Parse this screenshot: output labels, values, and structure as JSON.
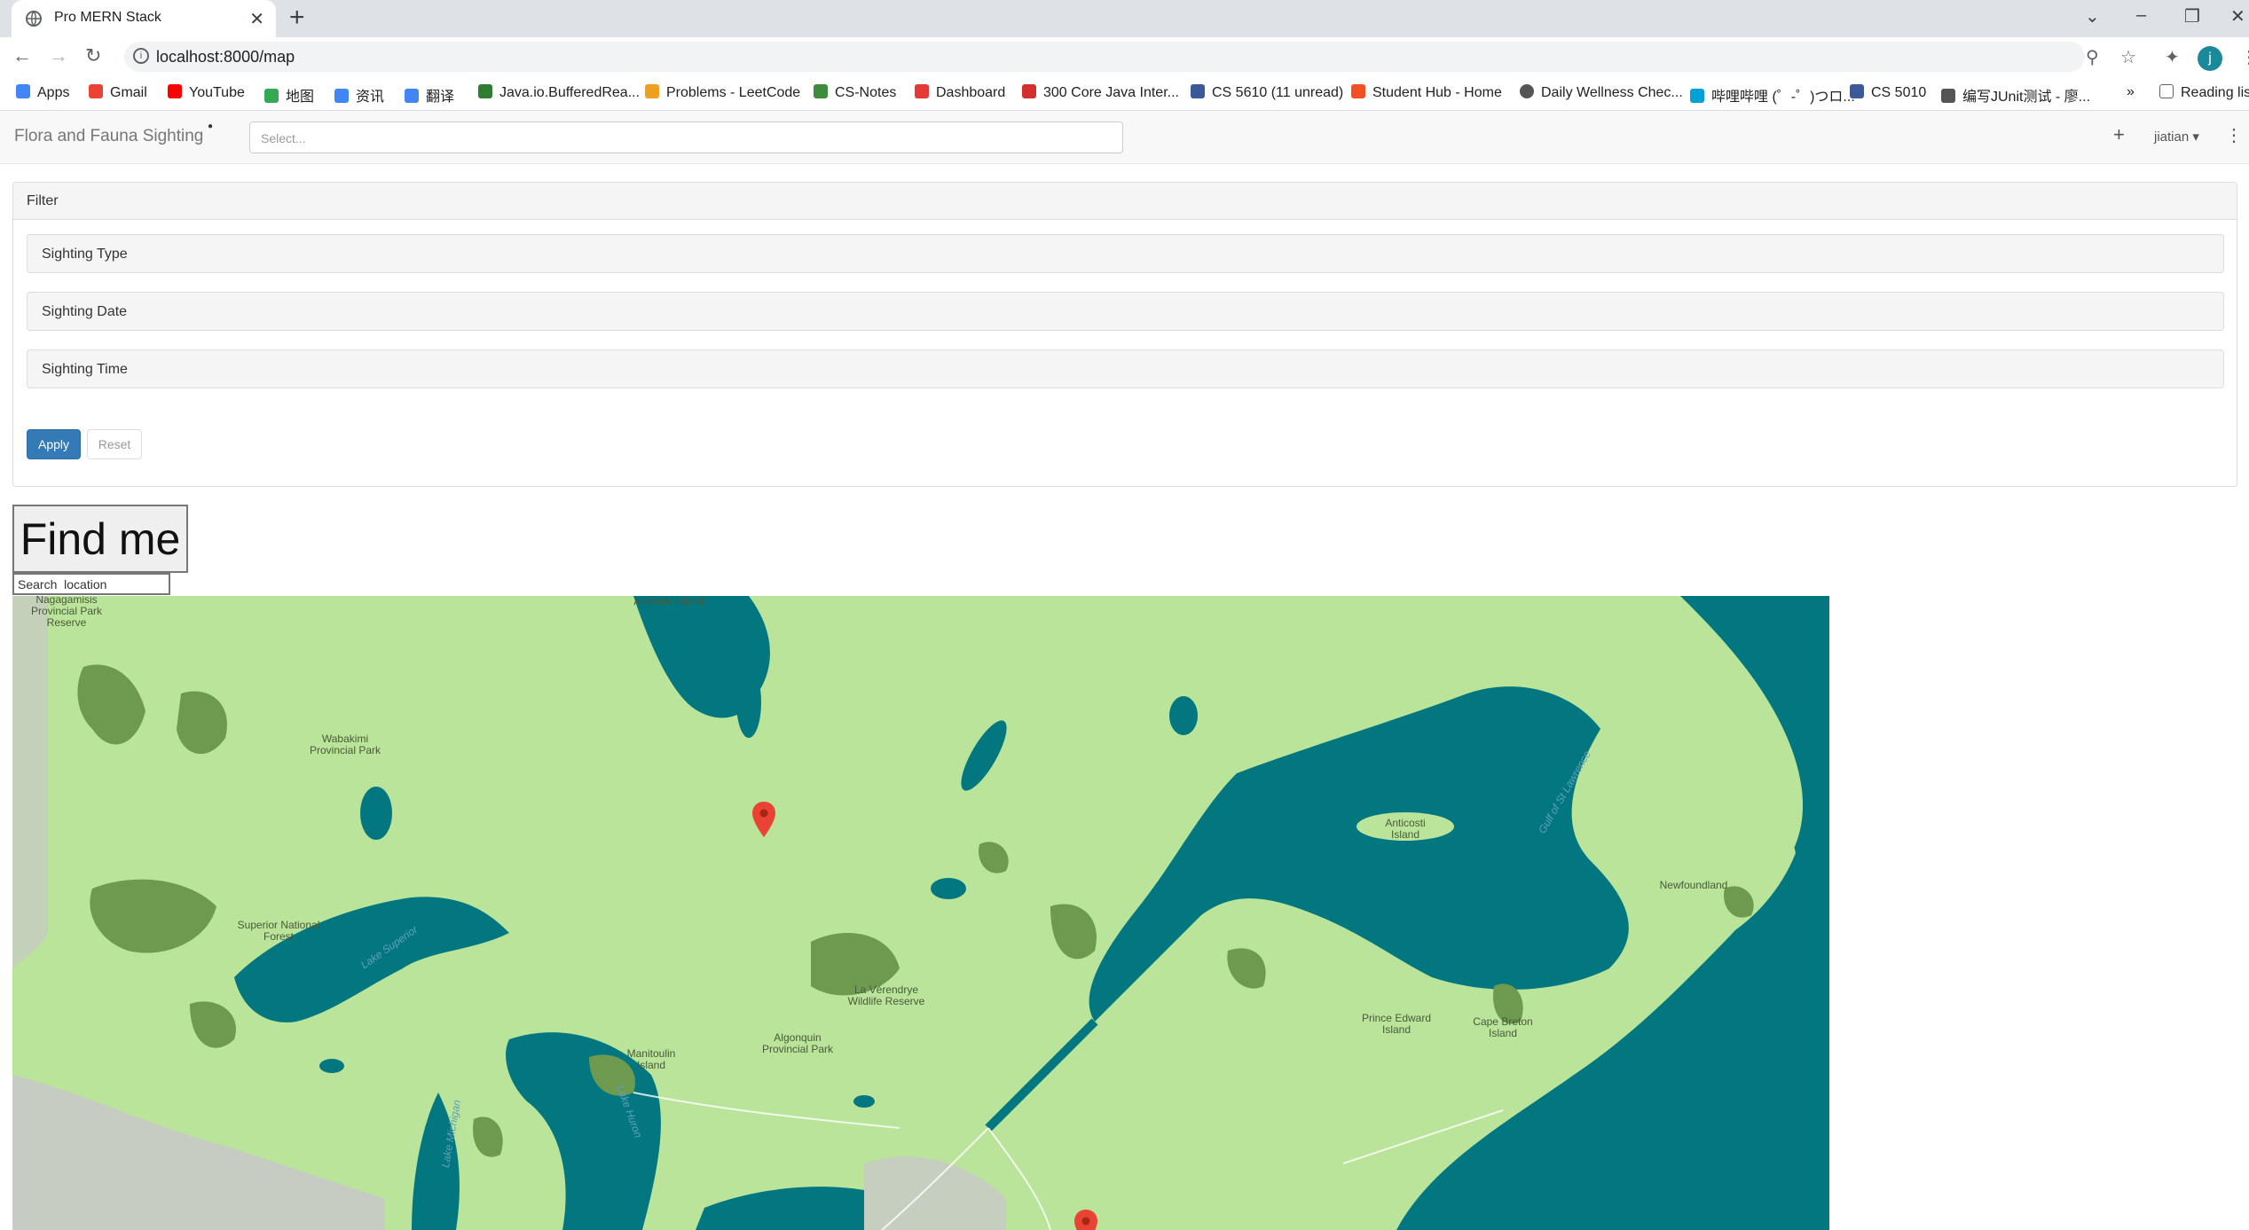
{
  "browser": {
    "tab_title": "Pro MERN Stack",
    "url": "localhost:8000/map",
    "bookmarks": [
      {
        "label": "Apps",
        "color": "#4285f4"
      },
      {
        "label": "Gmail",
        "color": "#ea4335"
      },
      {
        "label": "YouTube",
        "color": "#ff0000"
      },
      {
        "label": "地图",
        "color": "#34a853"
      },
      {
        "label": "资讯",
        "color": "#4285f4"
      },
      {
        "label": "翻译",
        "color": "#4285f4"
      },
      {
        "label": "Java.io.BufferedRea...",
        "color": "#2e7d32"
      },
      {
        "label": "Problems - LeetCode",
        "color": "#f0a020"
      },
      {
        "label": "CS-Notes",
        "color": "#3c8c3c"
      },
      {
        "label": "Dashboard",
        "color": "#e53935"
      },
      {
        "label": "300 Core Java Inter...",
        "color": "#d32f2f"
      },
      {
        "label": "CS 5610 (11 unread)",
        "color": "#3b5998"
      },
      {
        "label": "Student Hub - Home",
        "color": "#f25022"
      },
      {
        "label": "Daily Wellness Chec...",
        "color": "#555555"
      },
      {
        "label": "哔哩哔哩 (゜-゜)つロ...",
        "color": "#00a1d6"
      },
      {
        "label": "CS 5010",
        "color": "#3b5998"
      },
      {
        "label": "编写JUnit测试 - 廖...",
        "color": "#555555"
      }
    ],
    "bookmarks_overflow": "»",
    "reading_list": "Reading list",
    "profile_initial": "j"
  },
  "app": {
    "brand": "Flora and Fauna Sighting",
    "select_placeholder": "Select...",
    "nav_plus": "+",
    "user_menu": "jiatian ▾",
    "more_menu": "⋮"
  },
  "filter": {
    "heading": "Filter",
    "sections": [
      "Sighting Type",
      "Sighting Date",
      "Sighting Time"
    ],
    "apply_label": "Apply",
    "reset_label": "Reset"
  },
  "find_me_label": "Find me",
  "search_placeholder": "Search  location",
  "map": {
    "labels": [
      "Nagagamisis Provincial Park Reserve",
      "Akimiski Island",
      "Wabakimi Provincial Park",
      "Superior National Forest",
      "Lake Superior",
      "Anticosti Island",
      "Gulf of St Lawrence",
      "Newfoundland",
      "La Vérendrye Wildlife Reserve",
      "Algonquin Provincial Park",
      "Manitoulin Island",
      "Lake Huron",
      "Lake Michigan",
      "Prince Edward Island",
      "Cape Breton Island"
    ],
    "markers": 2,
    "colors": {
      "land": "#b9e49a",
      "forest": "#6e9a4f",
      "water": "#03777f",
      "urban": "#c8c8c8"
    }
  }
}
